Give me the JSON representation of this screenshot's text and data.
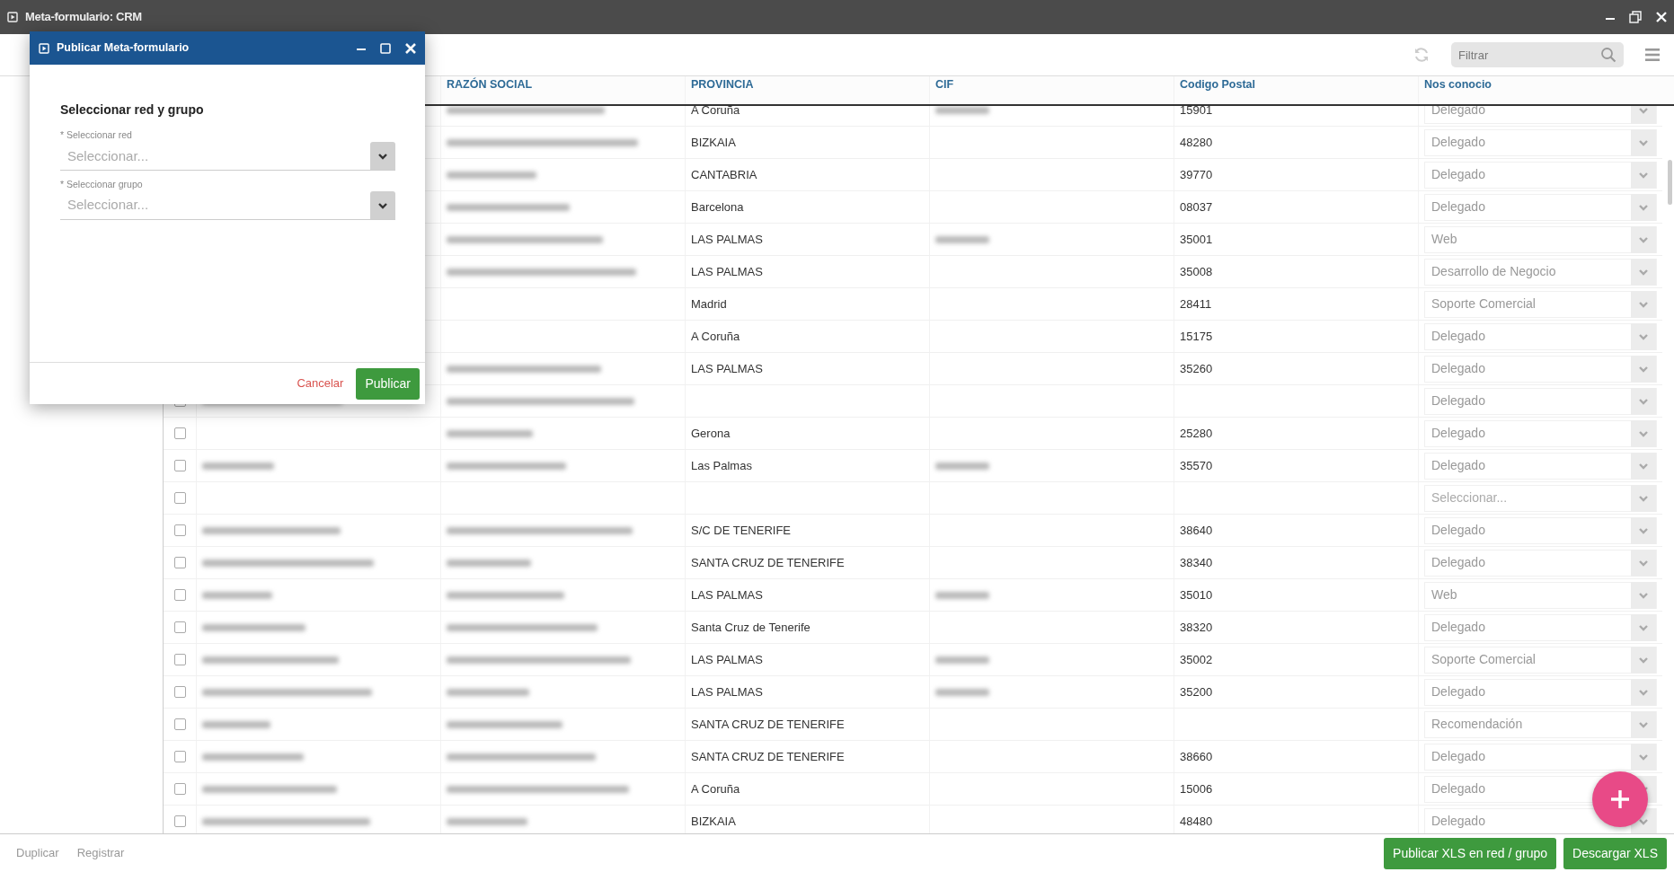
{
  "window": {
    "title": "Meta-formulario: CRM"
  },
  "toolbar": {
    "filter": {
      "placeholder": "Filtrar"
    }
  },
  "table": {
    "columns": [
      {
        "label": "RAZÓN SOCIAL"
      },
      {
        "label": "PROVINCIA"
      },
      {
        "label": "CIF"
      },
      {
        "label": "Codigo Postal"
      },
      {
        "label": "Nos conocio"
      }
    ],
    "rows": [
      {
        "razon_blurred": true,
        "cif_blurred": true,
        "provincia": "A Coruña",
        "postal_code": "15901",
        "source": "Delegado"
      },
      {
        "razon_blurred": true,
        "provincia": "BIZKAIA",
        "postal_code": "48280",
        "source": "Delegado"
      },
      {
        "razon_blurred": true,
        "provincia": "CANTABRIA",
        "postal_code": "39770",
        "source": "Delegado"
      },
      {
        "razon_blurred": true,
        "provincia": "Barcelona",
        "postal_code": "08037",
        "source": "Delegado"
      },
      {
        "razon_blurred": true,
        "cif_blurred": true,
        "provincia": "LAS PALMAS",
        "postal_code": "35001",
        "source": "Web"
      },
      {
        "razon_blurred": true,
        "provincia": "LAS PALMAS",
        "postal_code": "35008",
        "source": "Desarrollo de Negocio"
      },
      {
        "provincia": "Madrid",
        "postal_code": "28411",
        "source": "Soporte Comercial"
      },
      {
        "provincia": "A Coruña",
        "postal_code": "15175",
        "source": "Delegado"
      },
      {
        "razon_blurred": true,
        "provincia": "LAS PALMAS",
        "postal_code": "35260",
        "source": "Delegado"
      },
      {
        "checked": false,
        "name_blurred": true,
        "razon_blurred": true,
        "source": "Delegado"
      },
      {
        "checked": false,
        "razon_blurred": true,
        "provincia": "Gerona",
        "postal_code": "25280",
        "source": "Delegado"
      },
      {
        "checked": false,
        "name_blurred": true,
        "razon_blurred": true,
        "cif_blurred": true,
        "provincia": "Las Palmas",
        "postal_code": "35570",
        "source": "Delegado"
      },
      {
        "checked": false,
        "source_placeholder": "Seleccionar..."
      },
      {
        "checked": false,
        "name_blurred": true,
        "razon_blurred": true,
        "provincia": "S/C DE TENERIFE",
        "postal_code": "38640",
        "source": "Delegado"
      },
      {
        "checked": false,
        "name_blurred": true,
        "razon_blurred": true,
        "provincia": "SANTA CRUZ DE TENERIFE",
        "postal_code": "38340",
        "source": "Delegado"
      },
      {
        "checked": false,
        "name_blurred": true,
        "razon_blurred": true,
        "cif_blurred": true,
        "provincia": "LAS PALMAS",
        "postal_code": "35010",
        "source": "Web"
      },
      {
        "checked": false,
        "name_blurred": true,
        "razon_blurred": true,
        "provincia": "Santa Cruz de Tenerife",
        "postal_code": "38320",
        "source": "Delegado"
      },
      {
        "checked": false,
        "name_blurred": true,
        "razon_blurred": true,
        "cif_blurred": true,
        "provincia": "LAS PALMAS",
        "postal_code": "35002",
        "source": "Soporte Comercial"
      },
      {
        "checked": false,
        "name_blurred": true,
        "razon_blurred": true,
        "cif_blurred": true,
        "provincia": "LAS PALMAS",
        "postal_code": "35200",
        "source": "Delegado"
      },
      {
        "checked": false,
        "name_blurred": true,
        "razon_blurred": true,
        "provincia": "SANTA CRUZ DE TENERIFE",
        "source": "Recomendación"
      },
      {
        "checked": false,
        "name_blurred": true,
        "razon_blurred": true,
        "provincia": "SANTA CRUZ DE TENERIFE",
        "postal_code": "38660",
        "source": "Delegado"
      },
      {
        "checked": false,
        "name_blurred": true,
        "razon_blurred": true,
        "provincia": "A Coruña",
        "postal_code": "15006",
        "source": "Delegado"
      },
      {
        "checked": false,
        "name_blurred": true,
        "razon_blurred": true,
        "provincia": "BIZKAIA",
        "postal_code": "48480",
        "source": "Delegado"
      }
    ]
  },
  "footer": {
    "left_buttons": [
      {
        "label": "Duplicar",
        "disabled": true
      },
      {
        "label": "Registrar",
        "disabled": true
      }
    ],
    "right_buttons": [
      {
        "label": "Publicar XLS en red / grupo"
      },
      {
        "label": "Descargar XLS"
      }
    ]
  },
  "dialog": {
    "title": "Publicar Meta-formulario",
    "heading": "Seleccionar red y grupo",
    "fields": [
      {
        "label": "* Seleccionar red",
        "placeholder": "Seleccionar..."
      },
      {
        "label": "* Seleccionar grupo",
        "placeholder": "Seleccionar..."
      }
    ],
    "cancel": "Cancelar",
    "submit": "Publicar"
  }
}
